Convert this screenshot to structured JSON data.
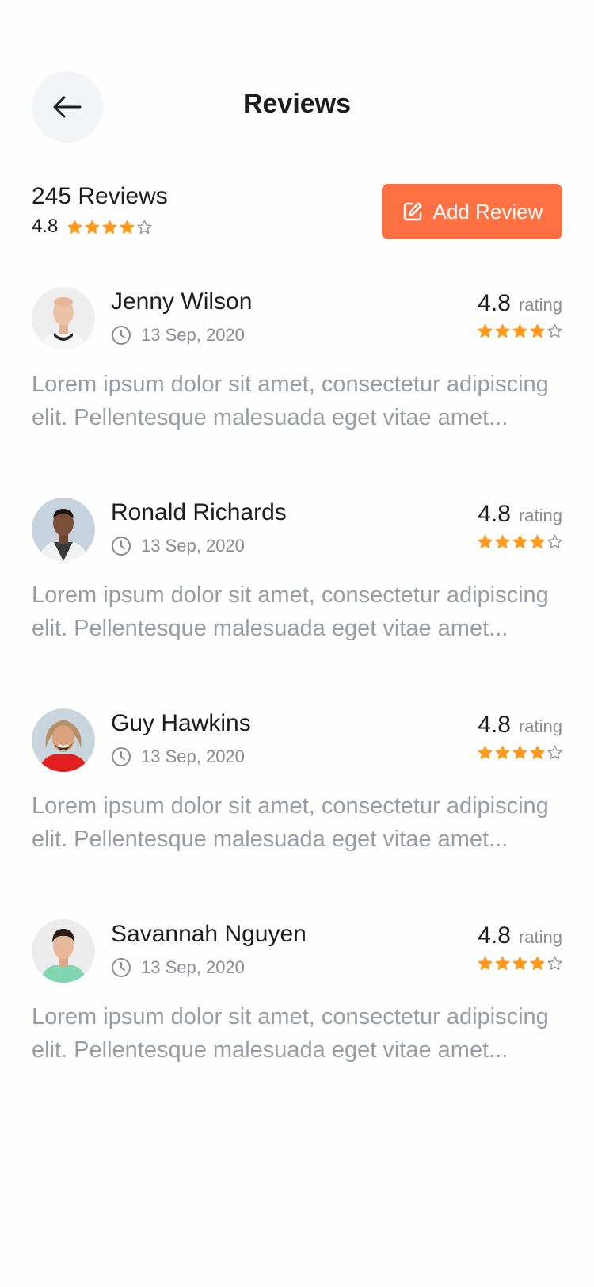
{
  "header": {
    "title": "Reviews"
  },
  "summary": {
    "count_label": "245 Reviews",
    "rating": "4.8",
    "stars": 4
  },
  "add_review": {
    "label": "Add Review"
  },
  "colors": {
    "accent": "#ff7043",
    "star": "#ff9a1f",
    "muted": "#9a9ca5"
  },
  "reviews": [
    {
      "name": "Jenny Wilson",
      "date": "13 Sep, 2020",
      "rating": "4.8",
      "rating_word": "rating",
      "stars": 4,
      "text": "Lorem ipsum dolor sit amet, consectetur adipiscing elit. Pellentesque malesuada eget vitae amet..."
    },
    {
      "name": "Ronald Richards",
      "date": "13 Sep, 2020",
      "rating": "4.8",
      "rating_word": "rating",
      "stars": 4,
      "text": "Lorem ipsum dolor sit amet, consectetur adipiscing elit. Pellentesque malesuada eget vitae amet..."
    },
    {
      "name": "Guy Hawkins",
      "date": "13 Sep, 2020",
      "rating": "4.8",
      "rating_word": "rating",
      "stars": 4,
      "text": "Lorem ipsum dolor sit amet, consectetur adipiscing elit. Pellentesque malesuada eget vitae amet..."
    },
    {
      "name": "Savannah Nguyen",
      "date": "13 Sep, 2020",
      "rating": "4.8",
      "rating_word": "rating",
      "stars": 4,
      "text": "Lorem ipsum dolor sit amet, consectetur adipiscing elit. Pellentesque malesuada eget vitae amet..."
    }
  ]
}
